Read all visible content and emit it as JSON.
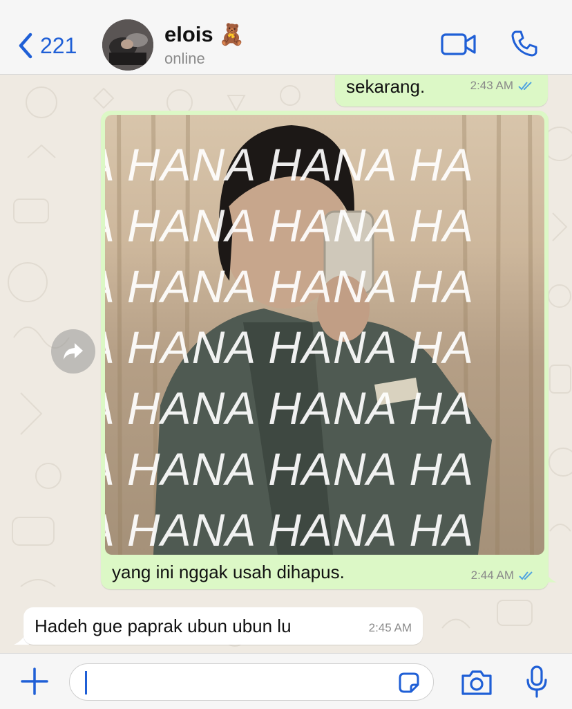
{
  "header": {
    "back_count": "221",
    "contact_name": "elois",
    "contact_emoji": "🧸",
    "status": "online",
    "icons": [
      "chevron-left-icon",
      "video-call-icon",
      "phone-icon"
    ],
    "accent_color": "#1f5fd6"
  },
  "messages": [
    {
      "direction": "outgoing",
      "text": "sekarang.",
      "time": "2:43 AM",
      "read": true
    },
    {
      "direction": "outgoing",
      "type": "image",
      "watermark": "HANA",
      "caption": "yang ini nggak usah dihapus.",
      "time": "2:44 AM",
      "read": true
    },
    {
      "direction": "incoming",
      "text": "Hadeh gue paprak ubun ubun lu",
      "time": "2:45 AM"
    }
  ],
  "input": {
    "value": "",
    "icons": [
      "plus-icon",
      "sticker-icon",
      "camera-icon",
      "microphone-icon"
    ]
  },
  "colors": {
    "outgoing_bubble": "#dcf8c6",
    "incoming_bubble": "#ffffff",
    "chat_background": "#efeae2",
    "read_ticks": "#4fa3e0"
  }
}
